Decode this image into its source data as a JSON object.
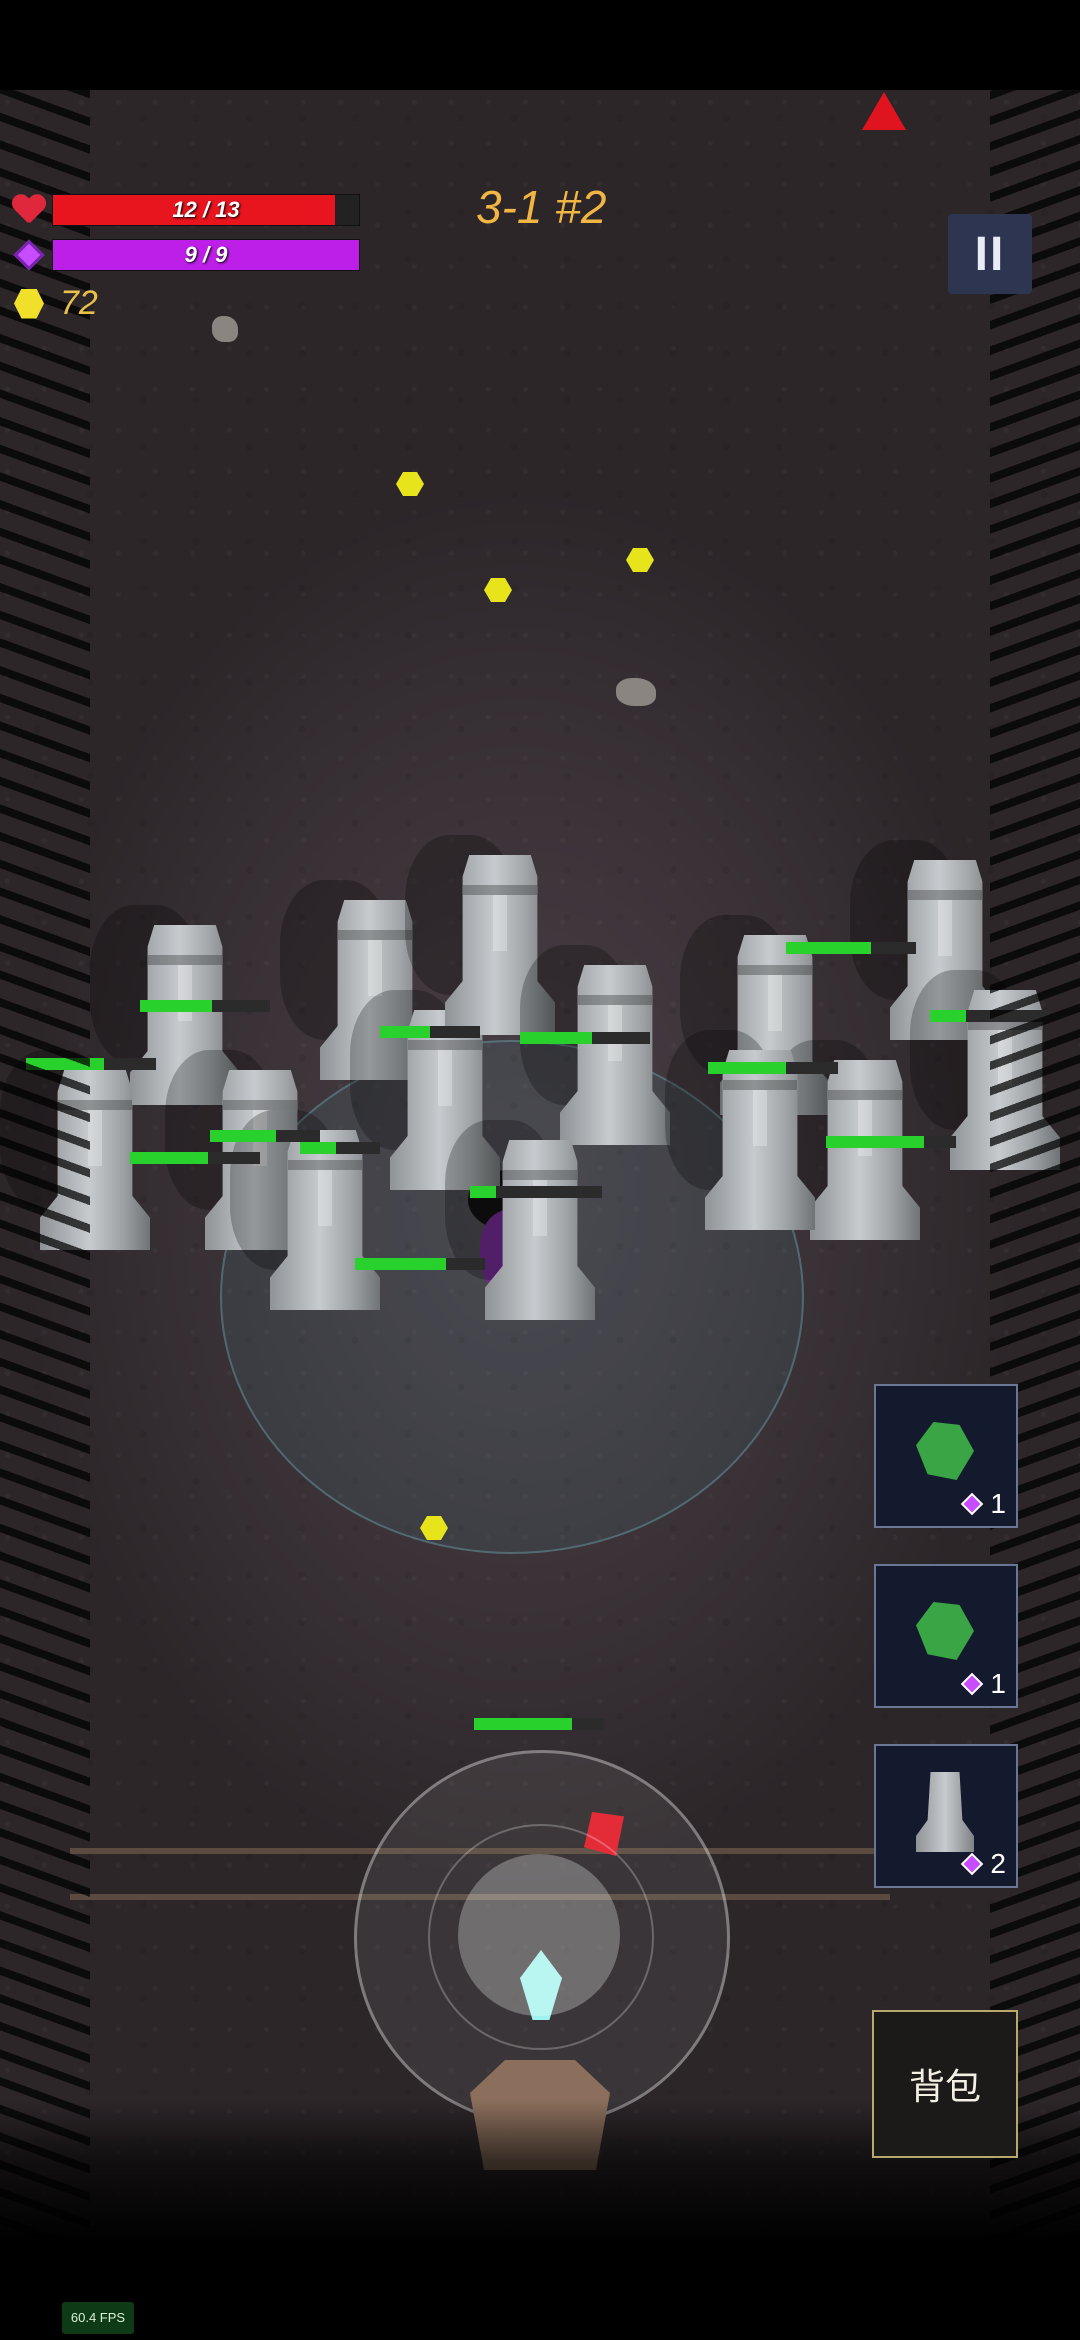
{
  "hud": {
    "health_text": "12 / 13",
    "health_fraction": 0.923,
    "mana_text": "9 / 9",
    "mana_fraction": 1.0,
    "coins": "72",
    "level": "3-1 #2",
    "pause_label": "II"
  },
  "skills": [
    {
      "icon": "emerald-icon",
      "cost": "1"
    },
    {
      "icon": "emerald-icon",
      "cost": "1"
    },
    {
      "icon": "moai-icon",
      "cost": "2"
    }
  ],
  "bag_label": "背包",
  "fps": "60.4 FPS",
  "colors": {
    "health": "#e8141e",
    "mana": "#bd1fe8",
    "coin": "#e9c14a",
    "enemy_hp": "#29d12c"
  },
  "enemies_hp_fraction": [
    0.55,
    0.6,
    0.5,
    0.55,
    0.45,
    0.7,
    0.6,
    0.2,
    0.65,
    0.3,
    0.75,
    0.6,
    0.6,
    0.7
  ]
}
